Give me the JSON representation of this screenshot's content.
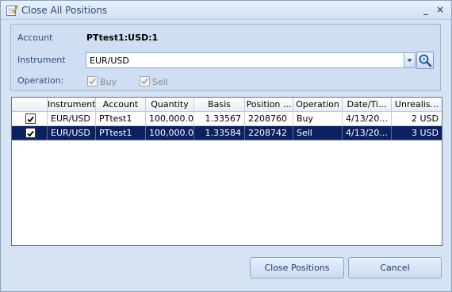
{
  "window": {
    "title": "Close All Positions",
    "minimize": "_",
    "close": "×"
  },
  "params": {
    "account_label": "Account",
    "account_value": "PTtest1:USD:1",
    "instrument_label": "Instrument",
    "instrument_value": "EUR/USD",
    "operation_label": "Operation:",
    "buy_label": "Buy",
    "buy_checked": true,
    "sell_label": "Sell",
    "sell_checked": true
  },
  "grid": {
    "columns": [
      "Instrument",
      "Account",
      "Quantity",
      "Basis",
      "Position ...",
      "Operation",
      "Date/Ti...",
      "Unrealis..."
    ],
    "rows": [
      {
        "checked": true,
        "instrument": "EUR/USD",
        "account": "PTtest1",
        "quantity": "100,000.00",
        "basis": "1.33567",
        "position": "2208760",
        "operation": "Buy",
        "date": "4/13/20...",
        "unrealised": "2 USD",
        "selected": false
      },
      {
        "checked": true,
        "instrument": "EUR/USD",
        "account": "PTtest1",
        "quantity": "100,000.00",
        "basis": "1.33584",
        "position": "2208742",
        "operation": "Sell",
        "date": "4/13/20...",
        "unrealised": "3 USD",
        "selected": true
      }
    ]
  },
  "buttons": {
    "close_positions": "Close Positions",
    "cancel": "Cancel"
  },
  "colors": {
    "selection": "#0b2161",
    "panel": "#cfdef2",
    "label": "#2d4e80"
  }
}
